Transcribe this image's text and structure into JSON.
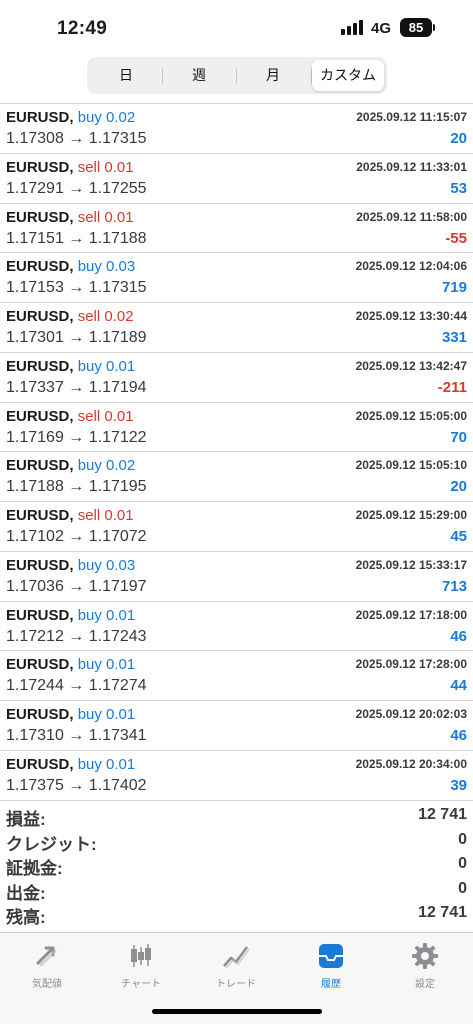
{
  "status": {
    "time": "12:49",
    "network": "4G",
    "battery": "85"
  },
  "segments": [
    "日",
    "週",
    "月",
    "カスタム"
  ],
  "active_segment": "カスタム",
  "trades": [
    {
      "symbol": "EURUSD,",
      "side": "buy 0.02",
      "side_type": "buy",
      "time": "2025.09.12 11:15:07",
      "prices": "1.17308 → 1.17315",
      "profit": "20",
      "profit_sign": "pos"
    },
    {
      "symbol": "EURUSD,",
      "side": "sell 0.01",
      "side_type": "sell",
      "time": "2025.09.12 11:33:01",
      "prices": "1.17291 → 1.17255",
      "profit": "53",
      "profit_sign": "pos"
    },
    {
      "symbol": "EURUSD,",
      "side": "sell 0.01",
      "side_type": "sell",
      "time": "2025.09.12 11:58:00",
      "prices": "1.17151 → 1.17188",
      "profit": "-55",
      "profit_sign": "neg"
    },
    {
      "symbol": "EURUSD,",
      "side": "buy 0.03",
      "side_type": "buy",
      "time": "2025.09.12 12:04:06",
      "prices": "1.17153 → 1.17315",
      "profit": "719",
      "profit_sign": "pos"
    },
    {
      "symbol": "EURUSD,",
      "side": "sell 0.02",
      "side_type": "sell",
      "time": "2025.09.12 13:30:44",
      "prices": "1.17301 → 1.17189",
      "profit": "331",
      "profit_sign": "pos"
    },
    {
      "symbol": "EURUSD,",
      "side": "buy 0.01",
      "side_type": "buy",
      "time": "2025.09.12 13:42:47",
      "prices": "1.17337 → 1.17194",
      "profit": "-211",
      "profit_sign": "neg"
    },
    {
      "symbol": "EURUSD,",
      "side": "sell 0.01",
      "side_type": "sell",
      "time": "2025.09.12 15:05:00",
      "prices": "1.17169 → 1.17122",
      "profit": "70",
      "profit_sign": "pos"
    },
    {
      "symbol": "EURUSD,",
      "side": "buy 0.02",
      "side_type": "buy",
      "time": "2025.09.12 15:05:10",
      "prices": "1.17188 → 1.17195",
      "profit": "20",
      "profit_sign": "pos"
    },
    {
      "symbol": "EURUSD,",
      "side": "sell 0.01",
      "side_type": "sell",
      "time": "2025.09.12 15:29:00",
      "prices": "1.17102 → 1.17072",
      "profit": "45",
      "profit_sign": "pos"
    },
    {
      "symbol": "EURUSD,",
      "side": "buy 0.03",
      "side_type": "buy",
      "time": "2025.09.12 15:33:17",
      "prices": "1.17036 → 1.17197",
      "profit": "713",
      "profit_sign": "pos"
    },
    {
      "symbol": "EURUSD,",
      "side": "buy 0.01",
      "side_type": "buy",
      "time": "2025.09.12 17:18:00",
      "prices": "1.17212 → 1.17243",
      "profit": "46",
      "profit_sign": "pos"
    },
    {
      "symbol": "EURUSD,",
      "side": "buy 0.01",
      "side_type": "buy",
      "time": "2025.09.12 17:28:00",
      "prices": "1.17244 → 1.17274",
      "profit": "44",
      "profit_sign": "pos"
    },
    {
      "symbol": "EURUSD,",
      "side": "buy 0.01",
      "side_type": "buy",
      "time": "2025.09.12 20:02:03",
      "prices": "1.17310 → 1.17341",
      "profit": "46",
      "profit_sign": "pos"
    },
    {
      "symbol": "EURUSD,",
      "side": "buy 0.01",
      "side_type": "buy",
      "time": "2025.09.12 20:34:00",
      "prices": "1.17375 → 1.17402",
      "profit": "39",
      "profit_sign": "pos"
    }
  ],
  "summary": [
    {
      "label": "損益:",
      "value": "12 741"
    },
    {
      "label": "クレジット:",
      "value": "0"
    },
    {
      "label": "証拠金:",
      "value": "0"
    },
    {
      "label": "出金:",
      "value": "0"
    },
    {
      "label": "残高:",
      "value": "12 741"
    }
  ],
  "tabbar": [
    {
      "label": "気配値",
      "icon": "quotes-arrows-icon",
      "active": false
    },
    {
      "label": "チャート",
      "icon": "candlestick-chart-icon",
      "active": false
    },
    {
      "label": "トレード",
      "icon": "trade-line-icon",
      "active": false
    },
    {
      "label": "履歴",
      "icon": "history-tray-icon",
      "active": true
    },
    {
      "label": "設定",
      "icon": "gear-icon",
      "active": false
    }
  ],
  "colors": {
    "buy": "#1a7bd7",
    "sell": "#d63a2f",
    "active_tab": "#1a7bd7",
    "inactive_tab": "#8e8e93"
  }
}
